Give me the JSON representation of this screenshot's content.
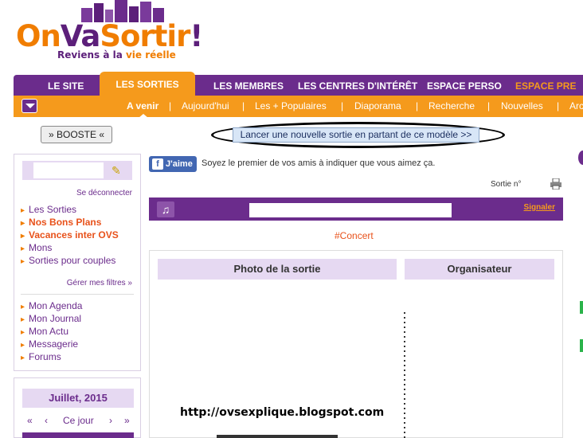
{
  "logo": {
    "brand_on": "On",
    "brand_va": "Va",
    "brand_sortir": "Sortir",
    "brand_bang": "!",
    "tagline_pre": "Reviens à la ",
    "tagline_em": "vie réelle"
  },
  "main_nav": {
    "items": [
      "LE SITE",
      "LES SORTIES",
      "LES MEMBRES",
      "LES CENTRES D'INTÉRÊT",
      "ESPACE PERSO",
      "ESPACE PRE"
    ],
    "active": "LES SORTIES"
  },
  "sub_nav": {
    "items": [
      "A venir",
      "Aujourd'hui",
      "Les + Populaires",
      "Diaporama",
      "Recherche",
      "Nouvelles",
      "Arc"
    ],
    "active": "A venir",
    "separator": "|"
  },
  "booste_label": "» BOOSTE «",
  "launch_label": "Lancer une nouvelle sortie en partant de ce modèle >>",
  "user_box": {
    "logout": "Se déconnecter",
    "links_a": [
      "Les Sorties",
      "Nos Bons Plans",
      "Vacances inter OVS",
      "Mons",
      "Sorties pour couples"
    ],
    "filters": "Gérer mes filtres »",
    "links_b": [
      "Mon Agenda",
      "Mon Journal",
      "Mon Actu",
      "Messagerie",
      "Forums"
    ]
  },
  "calendar": {
    "title": "Juillet, 2015",
    "nav_first": "«",
    "nav_prev": "‹",
    "today": "Ce jour",
    "nav_next": "›",
    "nav_last": "»"
  },
  "facebook": {
    "like": "J'aime",
    "prompt": "Soyez le premier de vos amis à indiquer que vous aimez ça."
  },
  "sortie_number_label": "Sortie n°",
  "report_label": "Signaler",
  "category_tag": "#Concert",
  "photo_header": "Photo de la sortie",
  "organizer_header": "Organisateur",
  "watermark": "http://ovsexplique.blogspot.com",
  "colors": {
    "purple": "#6b2c8c",
    "orange": "#f59a1c",
    "lavender": "#e6d9f2",
    "red_orange": "#e8521b",
    "fb_blue": "#4267b2"
  }
}
